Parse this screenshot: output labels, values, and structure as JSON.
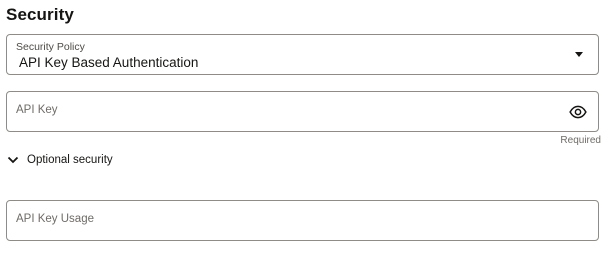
{
  "section": {
    "title": "Security"
  },
  "security_policy": {
    "label": "Security Policy",
    "value": "API Key Based Authentication"
  },
  "api_key": {
    "placeholder": "API Key",
    "required_text": "Required",
    "icon": "eye-icon"
  },
  "optional_security": {
    "label": "Optional security",
    "icon": "chevron-down-icon"
  },
  "api_key_usage": {
    "placeholder": "API Key Usage"
  }
}
